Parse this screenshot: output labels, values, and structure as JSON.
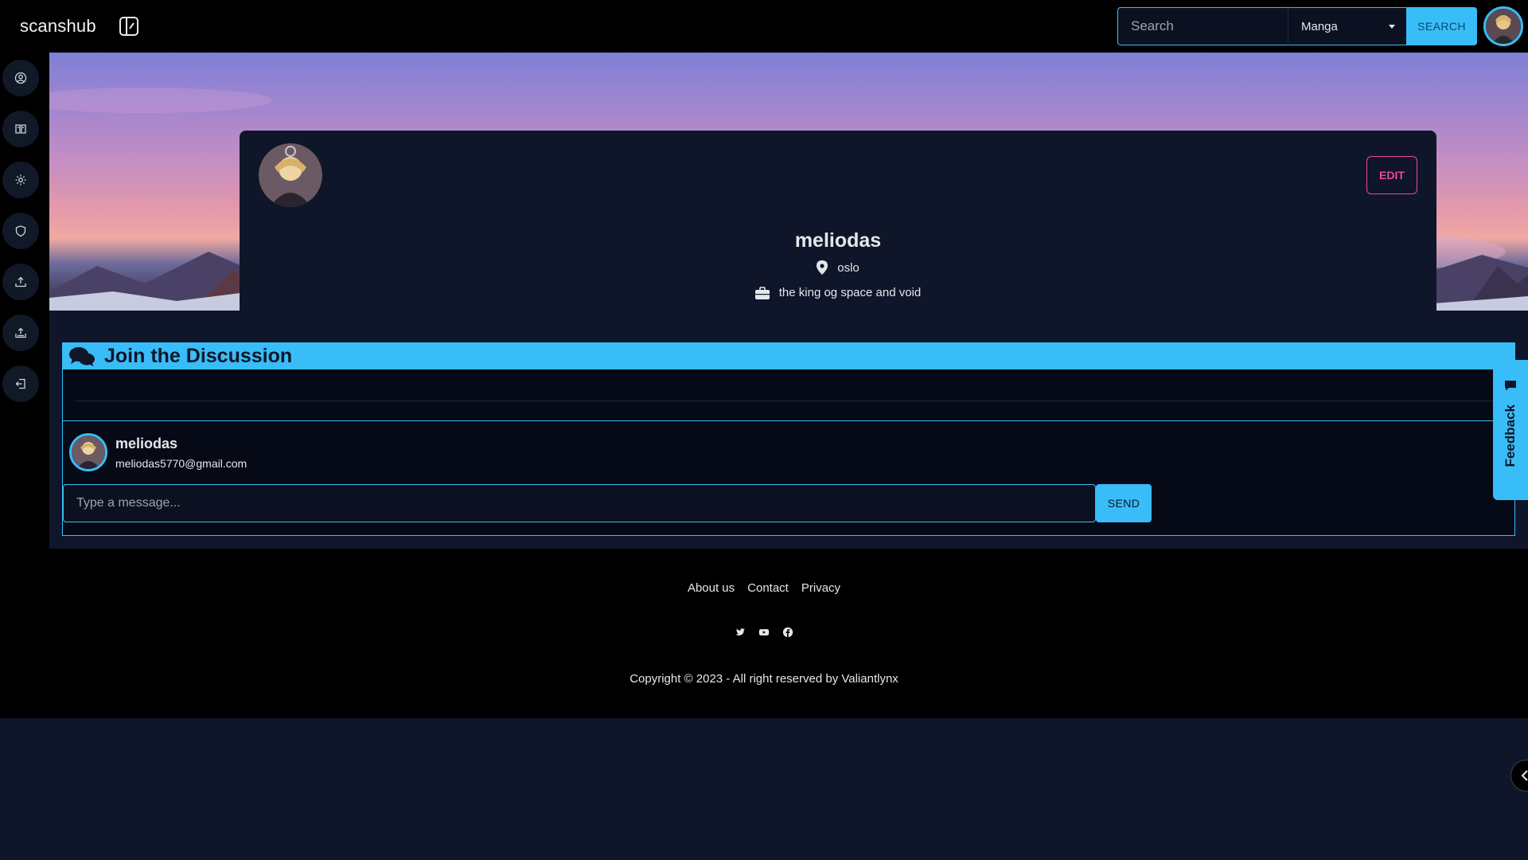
{
  "header": {
    "brand": "scanshub",
    "search_placeholder": "Search",
    "category_selected": "Manga",
    "search_button": "SEARCH"
  },
  "sidebar": {
    "items": [
      {
        "icon": "user-circle-icon"
      },
      {
        "icon": "book-icon"
      },
      {
        "icon": "gear-icon"
      },
      {
        "icon": "shield-icon"
      },
      {
        "icon": "upload-cloud-icon"
      },
      {
        "icon": "upload-tray-icon"
      },
      {
        "icon": "logout-icon"
      }
    ]
  },
  "profile": {
    "name": "meliodas",
    "location": "oslo",
    "occupation": "the king og space and void",
    "edit_button": "EDIT"
  },
  "discussion": {
    "title": "Join the Discussion",
    "user_name": "meliodas",
    "user_email": "meliodas5770@gmail.com",
    "message_placeholder": "Type a message...",
    "send_button": "SEND"
  },
  "feedback": {
    "label": "Feedback"
  },
  "footer": {
    "links": [
      "About us",
      "Contact",
      "Privacy"
    ],
    "social": [
      "twitter-icon",
      "youtube-icon",
      "facebook-icon"
    ],
    "copyright": "Copyright © 2023 - All right reserved by Valiantlynx"
  },
  "colors": {
    "accent": "#38bdf8",
    "edit": "#ec4899",
    "background": "#0f1629"
  }
}
